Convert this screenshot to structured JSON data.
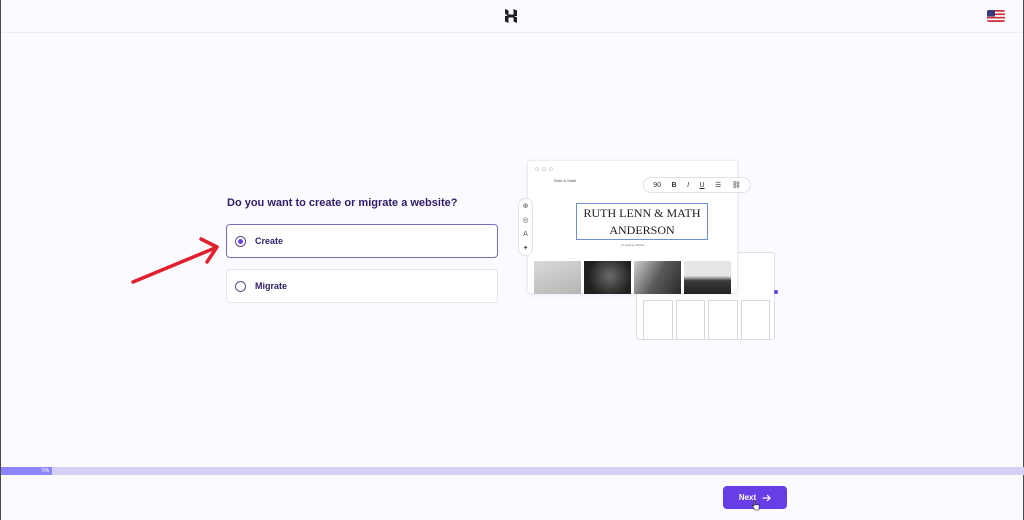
{
  "header": {
    "logo_icon": "hostinger-logo-icon",
    "language_icon": "us-flag-icon"
  },
  "main": {
    "question": "Do you want to create or migrate a website?",
    "options": [
      {
        "label": "Create",
        "selected": true
      },
      {
        "label": "Migrate",
        "selected": false
      }
    ]
  },
  "illustration": {
    "brand": "Ruth & Math",
    "title_line1": "RUTH LENN & MATH",
    "title_line2": "ANDERSON",
    "subtitle": "It's getting Official",
    "toolbar": {
      "size": "90",
      "bold": "B",
      "italic": "I",
      "underline": "U"
    }
  },
  "progress": {
    "label": "5%",
    "value": 0.05
  },
  "footer": {
    "next_label": "Next"
  },
  "colors": {
    "accent": "#673de6",
    "progress_fill": "#8c85ff",
    "annotation_arrow": "#e0202c"
  }
}
